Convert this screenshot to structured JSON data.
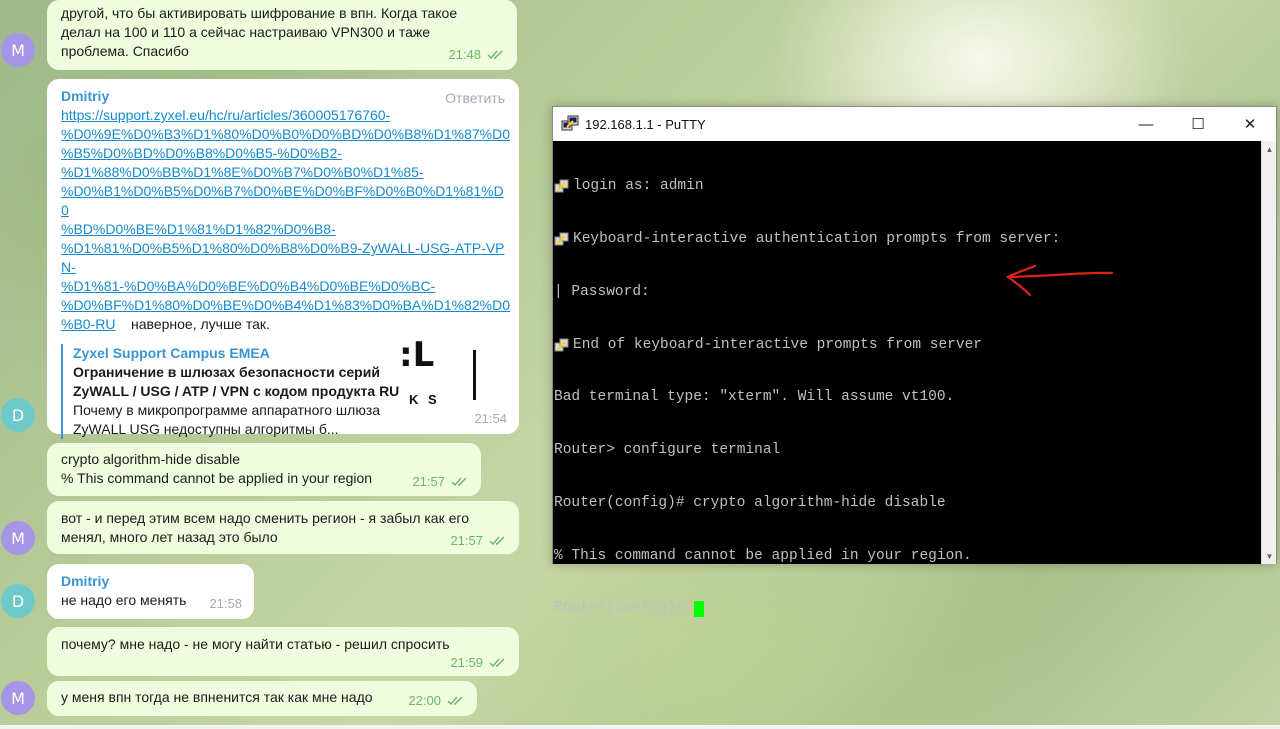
{
  "chat": {
    "msg1": {
      "avatar": "M",
      "lines": [
        "другой, что бы активировать шифрование в впн. Когда такое",
        "делал на 100 и 110 а сейчас настраиваю VPN300 и таже",
        "проблема. Спасибо"
      ],
      "time": "21:48"
    },
    "msg2": {
      "avatar": "D",
      "sender": "Dmitriy",
      "reply": "Ответить",
      "link_lines": [
        "https://support.zyxel.eu/hc/ru/articles/360005176760-",
        "%D0%9E%D0%B3%D1%80%D0%B0%D0%BD%D0%B8%D1%87%D0",
        "%B5%D0%BD%D0%B8%D0%B5-%D0%B2-",
        "%D1%88%D0%BB%D1%8E%D0%B7%D0%B0%D1%85-",
        "%D0%B1%D0%B5%D0%B7%D0%BE%D0%BF%D0%B0%D1%81%D0",
        "%BD%D0%BE%D1%81%D1%82%D0%B8-",
        "%D1%81%D0%B5%D1%80%D0%B8%D0%B9-ZyWALL-USG-ATP-VPN-",
        "%D1%81-%D0%BA%D0%BE%D0%B4%D0%BE%D0%BC-",
        "%D0%BF%D1%80%D0%BE%D0%B4%D1%83%D0%BA%D1%82%D0"
      ],
      "link_last": "%B0-RU",
      "after_link": "наверное, лучше так.",
      "preview_site": "Zyxel Support Campus EMEA",
      "preview_title": "Ограничение в шлюзах безопасности серий ZyWALL / USG / ATP / VPN с кодом продукта RU",
      "preview_desc": "Почему в микропрограмме аппаратного шлюза ZyWALL USG недоступны алгоритмы б...",
      "thumb_big": ":L",
      "thumb_small": "K S",
      "time": "21:54"
    },
    "msg3": {
      "lines": [
        "crypto algorithm-hide disable",
        "% This command cannot be applied in your region"
      ],
      "time": "21:57"
    },
    "msg4": {
      "avatar": "M",
      "lines": [
        "вот - и перед этим всем надо сменить регион - я забыл как его",
        "менял, много лет назад это было"
      ],
      "time": "21:57"
    },
    "msg5": {
      "avatar": "D",
      "sender": "Dmitriy",
      "text": "не надо его менять",
      "time": "21:58"
    },
    "msg6": {
      "text": "почему? мне надо - не могу найти статью - решил спросить",
      "time": "21:59"
    },
    "msg7": {
      "avatar": "M",
      "text": "у меня впн тогда не впненится так как мне надо",
      "time": "22:00"
    }
  },
  "putty": {
    "title": "192.168.1.1 - PuTTY",
    "minimize": "—",
    "maximize": "☐",
    "close": "✕",
    "lines": [
      "login as: admin",
      "Keyboard-interactive authentication prompts from server:",
      "| Password:",
      "End of keyboard-interactive prompts from server",
      "Bad terminal type: \"xterm\". Will assume vt100.",
      "Router> configure terminal",
      "Router(config)# crypto algorithm-hide disable",
      "% This command cannot be applied in your region.",
      "Router(config)# "
    ]
  },
  "colors": {
    "outgoing_bubble": "#effdde",
    "incoming_bubble": "#ffffff",
    "sender": "#3a95d5",
    "link": "#168acd",
    "time_out": "#6db566",
    "annotation": "#e0201a",
    "cursor": "#00ff00"
  }
}
